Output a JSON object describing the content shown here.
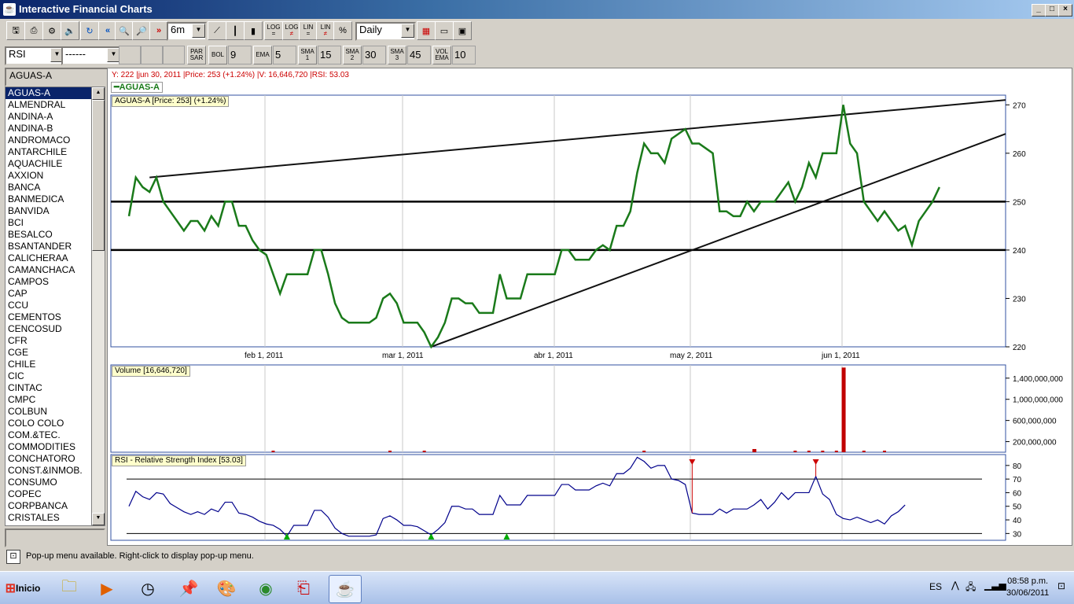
{
  "window": {
    "title": "Interactive Financial Charts"
  },
  "toolbar1": {
    "period": "6m",
    "log1": "LOG",
    "log2": "LOG",
    "lin1": "LIN",
    "lin2": "LIN",
    "pct": "%",
    "interval": "Daily"
  },
  "toolbar2": {
    "indicator": "RSI",
    "indicator2": "------",
    "par": "PAR SAR",
    "bol": "BOL",
    "bol_val": "9",
    "ema": "EMA",
    "ema_val": "5",
    "sma1": "SMA 1",
    "sma1_val": "15",
    "sma2": "SMA 2",
    "sma2_val": "30",
    "sma3": "SMA 3",
    "sma3_val": "45",
    "volema": "VOL EMA",
    "volema_val": "10"
  },
  "sidebar": {
    "search": "AGUAS-A",
    "items": [
      "AGUAS-A",
      "ALMENDRAL",
      "ANDINA-A",
      "ANDINA-B",
      "ANDROMACO",
      "ANTARCHILE",
      "AQUACHILE",
      "AXXION",
      "BANCA",
      "BANMEDICA",
      "BANVIDA",
      "BCI",
      "BESALCO",
      "BSANTANDER",
      "CALICHERAA",
      "CAMANCHACA",
      "CAMPOS",
      "CAP",
      "CCU",
      "CEMENTOS",
      "CENCOSUD",
      "CFR",
      "CGE",
      "CHILE",
      "CIC",
      "CINTAC",
      "CMPC",
      "COLBUN",
      "COLO COLO",
      "COM.&TEC.",
      "COMMODITIES",
      "CONCHATORO",
      "CONST.&INMOB.",
      "CONSUMO",
      "COPEC",
      "CORPBANCA",
      "CRISTALES"
    ]
  },
  "chart": {
    "info_line": "Y: 222 |jun 30, 2011 |Price: 253 (+1.24%) |V: 16,646,720 |RSI: 53.03",
    "legend": "AGUAS-A",
    "price_label": "AGUAS-A [Price: 253] (+1.24%)",
    "volume_label": "Volume [16,646,720]",
    "rsi_label": "RSI - Relative Strength Index [53.03]",
    "x_ticks": [
      "feb 1, 2011",
      "mar 1, 2011",
      "abr 1, 2011",
      "may 2, 2011",
      "jun 1, 2011"
    ],
    "price_ticks": [
      "270",
      "260",
      "250",
      "240",
      "230",
      "220"
    ],
    "volume_ticks": [
      "1,400,000,000",
      "1,000,000,000",
      "600,000,000",
      "200,000,000"
    ],
    "rsi_ticks": [
      "80",
      "70",
      "60",
      "50",
      "40",
      "30"
    ],
    "colors": {
      "price": "#1a7a1a",
      "volume": "#c00000",
      "rsi": "#00008b",
      "support": "#000000"
    }
  },
  "chart_data": {
    "type": "line",
    "series": [
      {
        "name": "AGUAS-A"
      }
    ],
    "price": {
      "ylim": [
        220,
        272
      ],
      "x": [
        0,
        1,
        2,
        3,
        4,
        5,
        6,
        7,
        8,
        9,
        10,
        11,
        12,
        13,
        14,
        15,
        16,
        17,
        18,
        19,
        20,
        21,
        22,
        23,
        24,
        25,
        26,
        27,
        28,
        29,
        30,
        31,
        32,
        33,
        34,
        35,
        36,
        37,
        38,
        39,
        40,
        41,
        42,
        43,
        44,
        45,
        46,
        47,
        48,
        49,
        50,
        51,
        52,
        53,
        54,
        55,
        56,
        57,
        58,
        59,
        60,
        61,
        62,
        63,
        64,
        65,
        66,
        67,
        68,
        69,
        70,
        71,
        72,
        73,
        74,
        75,
        76,
        77,
        78,
        79,
        80,
        81,
        82,
        83,
        84,
        85,
        86,
        87,
        88,
        89,
        90,
        91,
        92,
        93,
        94,
        95,
        96,
        97,
        98,
        99,
        100,
        101,
        102,
        103,
        104,
        105,
        106,
        107,
        108,
        109,
        110,
        111,
        112,
        113,
        114,
        115,
        116,
        117,
        118,
        119,
        120,
        121,
        122,
        123,
        124,
        125
      ],
      "values": [
        247,
        255,
        253,
        252,
        255,
        250,
        248,
        246,
        244,
        246,
        246,
        244,
        247,
        245,
        250,
        250,
        245,
        245,
        242,
        240,
        239,
        235,
        231,
        235,
        235,
        235,
        235,
        240,
        240,
        235,
        229,
        226,
        225,
        225,
        225,
        225,
        226,
        230,
        231,
        229,
        225,
        225,
        225,
        223,
        220,
        222,
        225,
        230,
        230,
        229,
        229,
        227,
        227,
        227,
        235,
        230,
        230,
        230,
        235,
        235,
        235,
        235,
        235,
        240,
        240,
        238,
        238,
        238,
        240,
        241,
        240,
        245,
        245,
        248,
        256,
        262,
        260,
        260,
        258,
        263,
        264,
        265,
        262,
        262,
        261,
        260,
        248,
        248,
        247,
        247,
        250,
        248,
        250,
        250,
        250,
        252,
        254,
        250,
        253,
        258,
        255,
        260,
        260,
        260,
        270,
        262,
        260,
        250,
        248,
        246,
        248,
        246,
        244,
        245,
        241,
        246,
        248,
        250,
        253
      ]
    },
    "x_dates": [
      "feb 1, 2011",
      "mar 1, 2011",
      "abr 1, 2011",
      "may 2, 2011",
      "jun 1, 2011"
    ],
    "horizontal_lines": [
      250,
      240
    ],
    "volume": {
      "ylim": [
        0,
        1650000000
      ],
      "spikes": [
        {
          "x": 104,
          "v": 1600000000
        },
        {
          "x": 91,
          "v": 60000000
        }
      ]
    },
    "rsi": {
      "ylim": [
        25,
        88
      ],
      "levels": [
        70,
        30
      ],
      "values": [
        50,
        61,
        57,
        55,
        60,
        59,
        52,
        49,
        46,
        44,
        46,
        44,
        48,
        46,
        53,
        53,
        45,
        44,
        42,
        39,
        37,
        36,
        33,
        28,
        36,
        36,
        36,
        47,
        47,
        42,
        34,
        30,
        28,
        28,
        28,
        28,
        29,
        41,
        43,
        40,
        36,
        36,
        35,
        32,
        29,
        33,
        38,
        50,
        50,
        48,
        48,
        44,
        44,
        44,
        58,
        51,
        51,
        51,
        58,
        58,
        58,
        58,
        58,
        66,
        66,
        62,
        62,
        62,
        65,
        67,
        65,
        74,
        74,
        78,
        86,
        83,
        78,
        80,
        80,
        70,
        69,
        66,
        45,
        44,
        44,
        44,
        48,
        45,
        48,
        48,
        48,
        51,
        55,
        48,
        53,
        60,
        55,
        60,
        60,
        60,
        72,
        59,
        55,
        44,
        41,
        40,
        42,
        40,
        38,
        40,
        37,
        43,
        46,
        51
      ],
      "sell_markers": [
        82,
        100
      ],
      "buy_markers": [
        23,
        44,
        55
      ]
    }
  },
  "statusbar": {
    "text": "Pop-up menu available. Right-click to display pop-up menu."
  },
  "taskbar": {
    "start": "Inicio",
    "lang": "ES",
    "time": "08:58 p.m.",
    "date": "30/06/2011"
  }
}
